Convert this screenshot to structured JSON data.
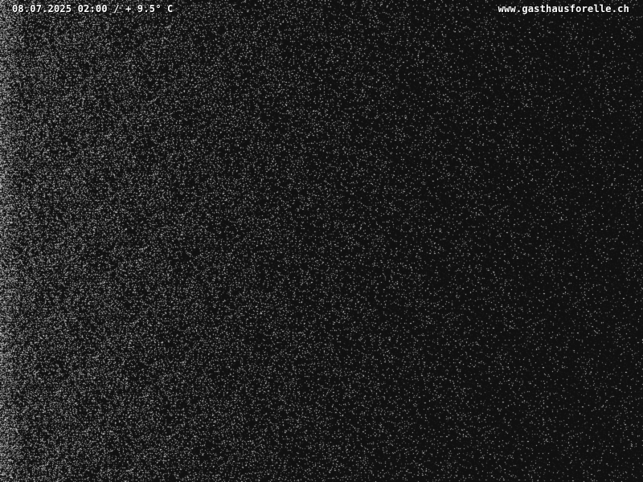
{
  "overlay": {
    "timestamp": "08.07.2025 02:00 / + 9.5° C",
    "website": "www.gasthausforelle.ch"
  },
  "image": {
    "content": "night-time webcam image",
    "background_color": "#101010",
    "noise_color": "#ffffff"
  }
}
